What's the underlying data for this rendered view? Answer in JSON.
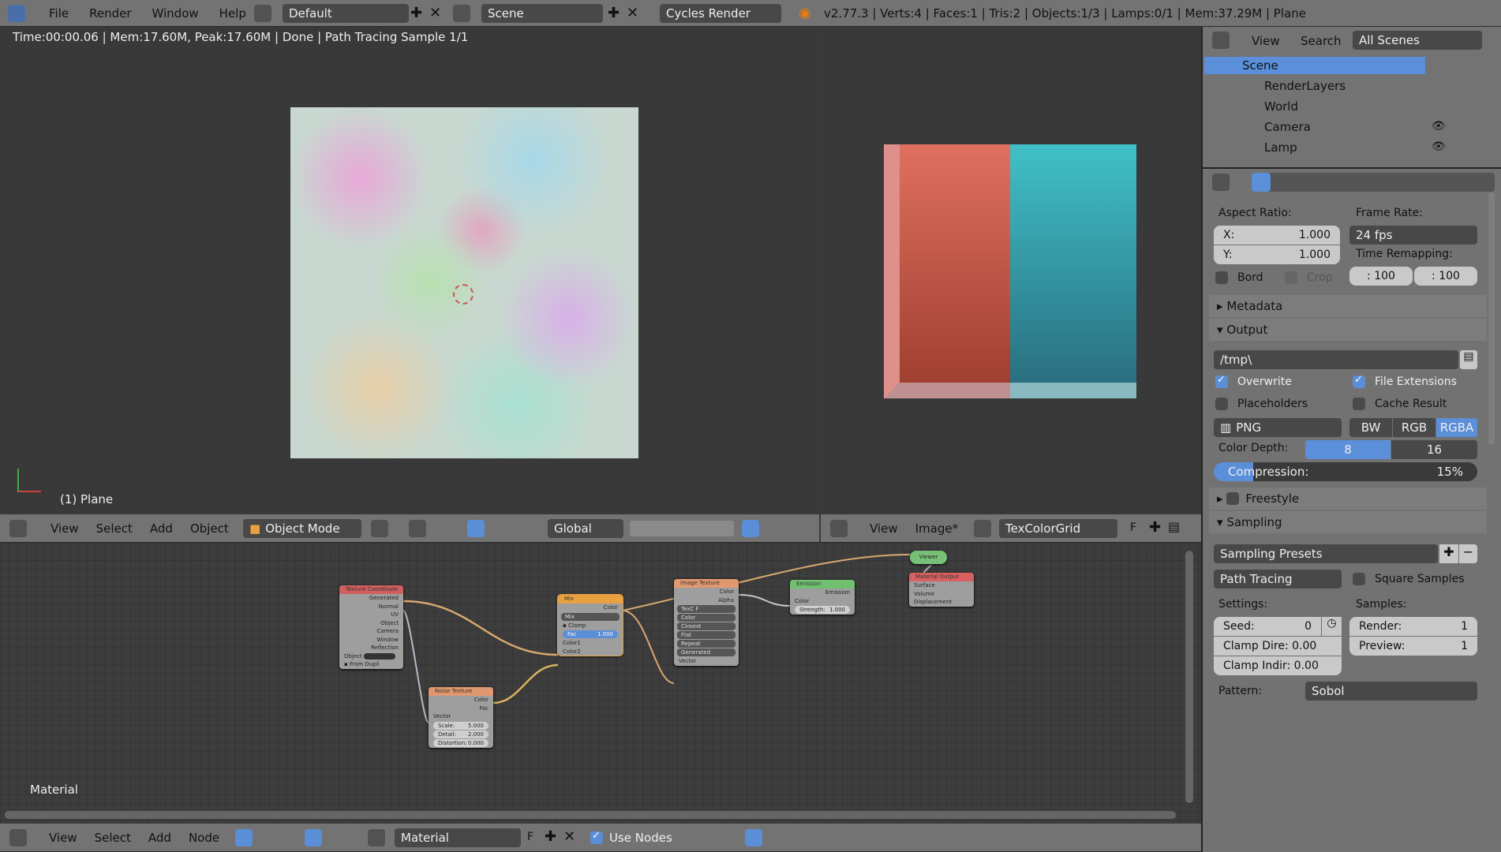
{
  "topbar": {
    "menus": [
      "File",
      "Render",
      "Window",
      "Help"
    ],
    "layout": "Default",
    "scene": "Scene",
    "engine": "Cycles Render",
    "stats": "v2.77.3 | Verts:4 | Faces:1 | Tris:2 | Objects:1/3 | Lamps:0/1 | Mem:37.29M | Plane"
  },
  "viewport": {
    "render_info": "Time:00:00.06 | Mem:17.60M, Peak:17.60M | Done | Path Tracing Sample 1/1",
    "object_label": "(1) Plane",
    "header": {
      "menus": [
        "View",
        "Select",
        "Add",
        "Object"
      ],
      "mode": "Object Mode",
      "orientation": "Global"
    }
  },
  "image_editor": {
    "header": {
      "menus": [
        "View",
        "Image*"
      ],
      "image_name": "TexColorGrid",
      "fake_user": "F"
    }
  },
  "outliner": {
    "menus": [
      "View",
      "Search"
    ],
    "filter": "All Scenes",
    "items": [
      "Scene",
      "RenderLayers",
      "World",
      "Camera",
      "Lamp"
    ]
  },
  "properties": {
    "aspect_label": "Aspect Ratio:",
    "aspect_x_label": "X:",
    "aspect_x": "1.000",
    "aspect_y_label": "Y:",
    "aspect_y": "1.000",
    "frame_rate_label": "Frame Rate:",
    "frame_rate": "24 fps",
    "time_remap_label": "Time Remapping:",
    "remap_old": ": 100",
    "remap_new": ": 100",
    "bord": "Bord",
    "crop": "Crop",
    "metadata": "Metadata",
    "output": "Output",
    "path": "/tmp\\",
    "overwrite": "Overwrite",
    "file_ext": "File Extensions",
    "placeholders": "Placeholders",
    "cache": "Cache Result",
    "format": "PNG",
    "color_modes": [
      "BW",
      "RGB",
      "RGBA"
    ],
    "color_mode_selected": "RGBA",
    "depth_label": "Color Depth:",
    "depths": [
      "8",
      "16"
    ],
    "depth_selected": "8",
    "compression_label": "Compression:",
    "compression": "15%",
    "compression_value": 15,
    "freestyle": "Freestyle",
    "sampling": "Sampling",
    "presets": "Sampling Presets",
    "integrator": "Path Tracing",
    "square": "Square Samples",
    "settings_label": "Settings:",
    "samples_label": "Samples:",
    "seed_label": "Seed:",
    "seed": "0",
    "clamp_dir": "Clamp Dire: 0.00",
    "clamp_ind": "Clamp Indir: 0.00",
    "render_label": "Render:",
    "render": "1",
    "preview_label": "Preview:",
    "preview": "1",
    "pattern_label": "Pattern:",
    "pattern": "Sobol"
  },
  "node_editor": {
    "label": "Material",
    "header": {
      "menus": [
        "View",
        "Select",
        "Add",
        "Node"
      ],
      "material": "Material",
      "fake_user": "F",
      "use_nodes": "Use Nodes"
    },
    "nodes": {
      "texcoord": {
        "title": "Texture Coordinate",
        "outputs": [
          "Generated",
          "Normal",
          "UV",
          "Object",
          "Camera",
          "Window",
          "Reflection"
        ],
        "object_label": "Object",
        "from_dupli": "From Dupli"
      },
      "noise": {
        "title": "Noise Texture",
        "outputs": [
          "Color",
          "Fac"
        ],
        "input": "Vector",
        "scale_l": "Scale:",
        "scale": "5.000",
        "detail_l": "Detail:",
        "detail": "2.000",
        "dist_l": "Distortion:",
        "dist": "0.000"
      },
      "mix": {
        "title": "Mix",
        "output": "Color",
        "blend": "Mix",
        "clamp": "Clamp",
        "fac_l": "Fac",
        "fac": "1.000",
        "inputs": [
          "Color1",
          "Color2"
        ]
      },
      "image": {
        "title": "Image Texture",
        "outputs": [
          "Color",
          "Alpha"
        ],
        "image": "TexC",
        "f": "F",
        "options": [
          "Color",
          "Closest",
          "Flat",
          "Repeat",
          "Generated"
        ],
        "input": "Vector"
      },
      "emission": {
        "title": "Emission",
        "output": "Emission",
        "input": "Color",
        "strength_l": "Strength:",
        "strength": "1.000"
      },
      "viewer": {
        "title": "Viewer"
      },
      "matout": {
        "title": "Material Output",
        "inputs": [
          "Surface",
          "Volume",
          "Displacement"
        ]
      }
    }
  },
  "colors": {
    "accent": "#5a8ed6",
    "header": "#737373",
    "viewport": "#393939",
    "selected": "#5b8fd9"
  }
}
